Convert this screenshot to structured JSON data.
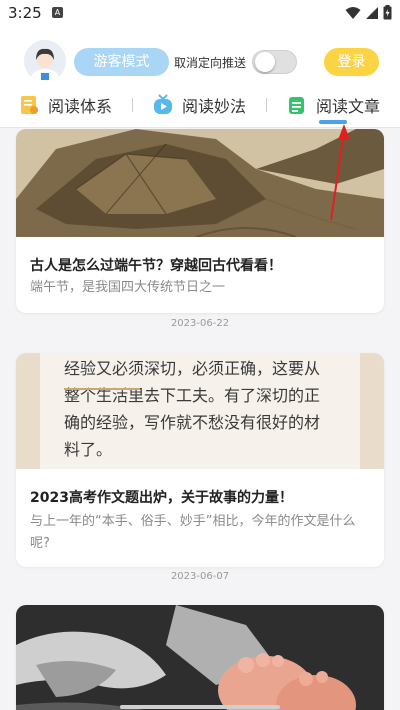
{
  "status_bar": {
    "time": "3:25",
    "notif_glyph": "A"
  },
  "header": {
    "guest_mode": "游客模式",
    "push_label": "取消定向推送",
    "push_enabled": false,
    "login": "登录"
  },
  "tabs": [
    {
      "label": "阅读体系",
      "icon": "book-icon",
      "active": false
    },
    {
      "label": "阅读妙法",
      "icon": "tv-icon",
      "active": false
    },
    {
      "label": "阅读文章",
      "icon": "document-icon",
      "active": true
    }
  ],
  "articles": [
    {
      "title": "古人是怎么过端午节？穿越回古代看看！",
      "subtitle": "端午节，是我国四大传统节日之一",
      "date": "2023-06-22"
    },
    {
      "title": "2023高考作文题出炉，关于故事的力量！",
      "subtitle": "与上一年的“本手、俗手、妙手”相比，今年的作文是什么呢?",
      "date": "2023-06-07",
      "image_text": [
        "经验又必须深切，必须正确，这要从",
        "整个生活里去下工夫。有了深切的正",
        "确的经验，写作就不愁没有很好的材",
        "料了。"
      ]
    },
    {
      "title": "",
      "subtitle": "",
      "date": ""
    }
  ],
  "colors": {
    "guest_btn": "#a9d6f5",
    "login_btn": "#fcd443",
    "tab_indicator": "#4aa3e8",
    "arrow": "#e02020"
  }
}
